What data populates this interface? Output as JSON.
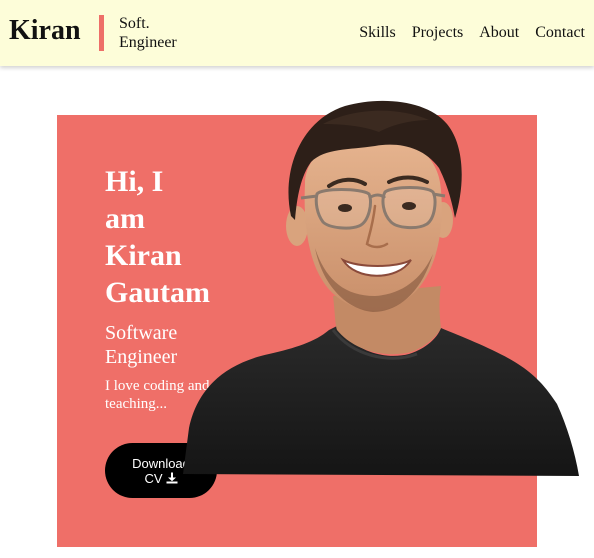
{
  "header": {
    "logo": "Kiran",
    "tagline_line1": "Soft.",
    "tagline_line2": "Engineer",
    "nav": [
      "Skills",
      "Projects",
      "About",
      "Contact"
    ]
  },
  "hero": {
    "title_lines": [
      "Hi, I",
      "am",
      "Kiran",
      "Gautam"
    ],
    "role_lines": [
      "Software",
      "Engineer"
    ],
    "desc_lines": [
      "I love coding and",
      "teaching..."
    ],
    "button_line1": "Download",
    "button_line2": "CV",
    "button_icon": "download-icon"
  },
  "colors": {
    "header_bg": "#fdfdd9",
    "accent": "#ef6f68",
    "button_bg": "#000000",
    "text_light": "#ffffff",
    "text_dark": "#111111"
  }
}
